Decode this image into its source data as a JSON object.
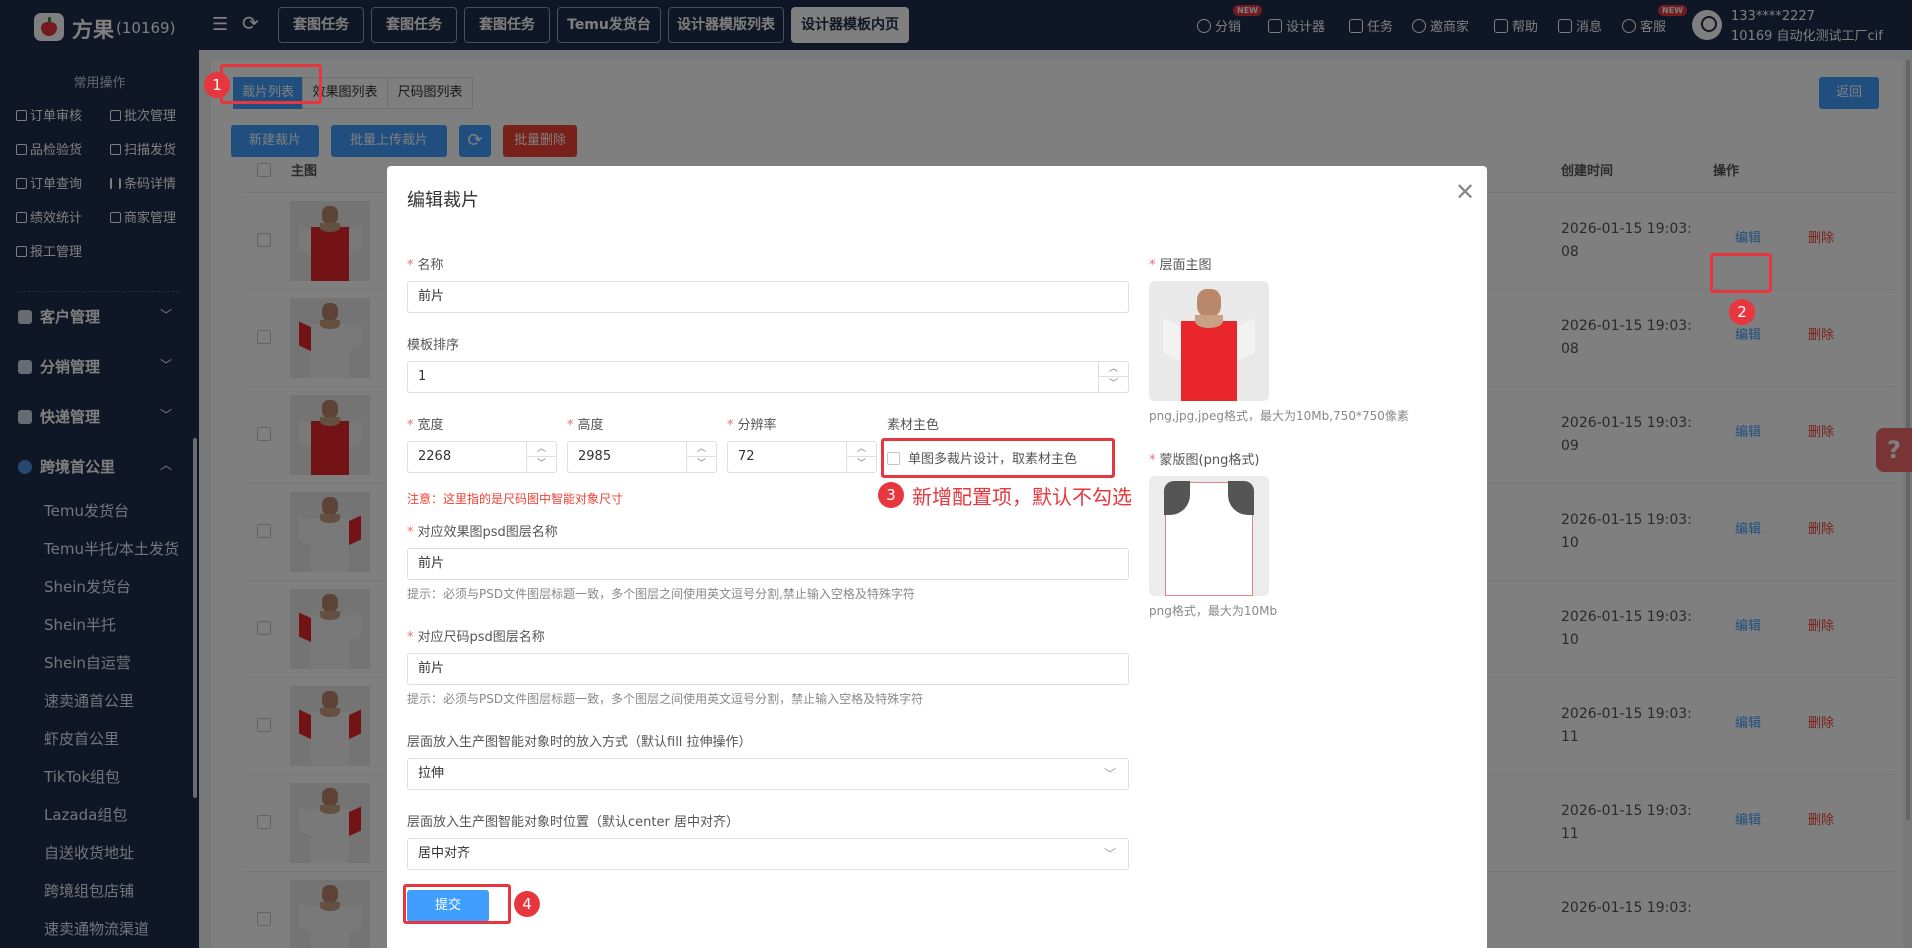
{
  "app": {
    "brand": "方果",
    "brand_count": "(10169)"
  },
  "top_tabs": [
    "套图任务",
    "套图任务",
    "套图任务",
    "Temu发货台",
    "设计器模版列表",
    "设计器模板内页"
  ],
  "top_nav": {
    "distribution": "分销",
    "designer": "设计器",
    "tasks": "任务",
    "invite": "邀商家",
    "help": "帮助",
    "messages": "消息",
    "service": "客服",
    "new_badge": "NEW",
    "user_phone": "133****2227",
    "user_shop": "10169 自动化测试工厂cif"
  },
  "sidebar": {
    "common_title": "常用操作",
    "quick_links": [
      "订单审核",
      "批次管理",
      "品检验货",
      "扫描发货",
      "订单查询",
      "条码详情",
      "绩效统计",
      "商家管理",
      "报工管理"
    ],
    "groups": [
      "客户管理",
      "分销管理",
      "快递管理",
      "跨境首公里"
    ],
    "sub_items": [
      "Temu发货台",
      "Temu半托/本土发货",
      "Shein发货台",
      "Shein半托",
      "Shein自运营",
      "速卖通首公里",
      "虾皮首公里",
      "TikTok组包",
      "Lazada组包",
      "自送收货地址",
      "跨境组包店铺",
      "速卖通物流渠道"
    ]
  },
  "page": {
    "tabs": [
      "裁片列表",
      "效果图列表",
      "尺码图列表"
    ],
    "back": "返回",
    "actions": {
      "new": "新建裁片",
      "batch_upload": "批量上传裁片",
      "batch_delete": "批量删除"
    },
    "columns": {
      "main_image": "主图",
      "created": "创建时间",
      "operation": "操作"
    },
    "rows": [
      {
        "d1": "2026-01-15 19:03:",
        "d2": "08",
        "edit": "编辑",
        "del": "删除"
      },
      {
        "d1": "2026-01-15 19:03:",
        "d2": "08",
        "edit": "编辑",
        "del": "删除"
      },
      {
        "d1": "2026-01-15 19:03:",
        "d2": "09",
        "edit": "编辑",
        "del": "删除"
      },
      {
        "d1": "2026-01-15 19:03:",
        "d2": "10",
        "edit": "编辑",
        "del": "删除"
      },
      {
        "d1": "2026-01-15 19:03:",
        "d2": "10",
        "edit": "编辑",
        "del": "删除"
      },
      {
        "d1": "2026-01-15 19:03:",
        "d2": "11",
        "edit": "编辑",
        "del": "删除"
      },
      {
        "d1": "2026-01-15 19:03:",
        "d2": "11",
        "edit": "编辑",
        "del": "删除"
      },
      {
        "d1": "2026-01-15 19:03:",
        "d2": "",
        "edit": "",
        "del": ""
      }
    ]
  },
  "dialog": {
    "title": "编辑裁片",
    "name_label": "名称",
    "name_value": "前片",
    "sort_label": "模板排序",
    "sort_value": "1",
    "width_label": "宽度",
    "width_value": "2268",
    "height_label": "高度",
    "height_value": "2985",
    "dpi_label": "分辨率",
    "dpi_value": "72",
    "color_label": "素材主色",
    "color_checkbox": "单图多裁片设计，取素材主色",
    "size_note": "注意：这里指的是尺码图中智能对象尺寸",
    "effect_psd_label": "对应效果图psd图层名称",
    "effect_psd_value": "前片",
    "effect_psd_hint": "提示：必须与PSD文件图层标题一致，多个图层之间使用英文逗号分割,禁止输入空格及特殊字符",
    "size_psd_label": "对应尺码psd图层名称",
    "size_psd_value": "前片",
    "size_psd_hint": "提示：必须与PSD文件图层标题一致，多个图层之间使用英文逗号分割，禁止输入空格及特殊字符",
    "placement_label": "层面放入生产图智能对象时的放入方式（默认fill 拉伸操作）",
    "placement_value": "拉伸",
    "position_label": "层面放入生产图智能对象时位置（默认center 居中对齐）",
    "position_value": "居中对齐",
    "submit": "提交",
    "main_img_label": "层面主图",
    "main_img_hint": "png,jpg,jpeg格式，最大为10Mb,750*750像素",
    "mask_label": "蒙版图(png格式)",
    "mask_hint": "png格式，最大为10Mb"
  },
  "annotations": {
    "m1": "1",
    "m2": "2",
    "m3": "3",
    "m4": "4",
    "callout": "新增配置项，默认不勾选"
  },
  "colors": {
    "primary": "#409eff",
    "danger": "#f04134",
    "sidebar": "#1f2d4a",
    "highlight": "#e8363f"
  }
}
